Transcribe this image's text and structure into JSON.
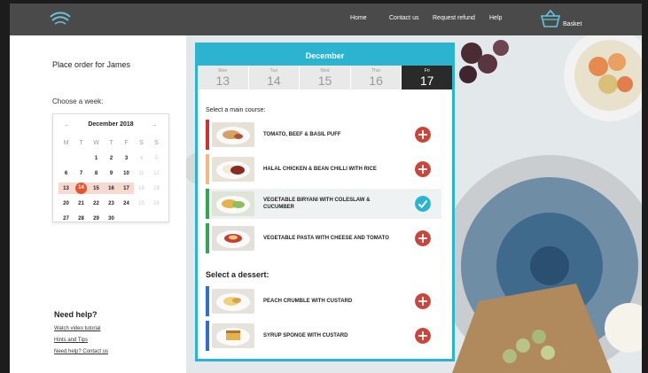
{
  "header": {
    "nav": [
      "Home",
      "Contact us",
      "Request refund",
      "Help"
    ],
    "basket_label": "Basket",
    "colors": {
      "bar": "#4a4a4a",
      "accent": "#2bb3cf"
    }
  },
  "sidebar": {
    "title": "Place order for James",
    "week_label": "Choose a week:",
    "calendar": {
      "month": "December 2018",
      "prev": "←",
      "next": "→",
      "dow": [
        "M",
        "T",
        "W",
        "T",
        "F",
        "S",
        "S"
      ],
      "weeks": [
        [
          "",
          "",
          "1",
          "2",
          "3",
          "4",
          "5"
        ],
        [
          "6",
          "7",
          "8",
          "9",
          "10",
          "11",
          "12"
        ],
        [
          "13",
          "14",
          "15",
          "16",
          "17",
          "18",
          "19"
        ],
        [
          "20",
          "21",
          "22",
          "23",
          "24",
          "25",
          "26"
        ],
        [
          "27",
          "28",
          "29",
          "30",
          "",
          "",
          ""
        ]
      ],
      "today": "14",
      "selected_week": [
        "13",
        "14",
        "15",
        "16",
        "17"
      ]
    },
    "help_title": "Need help?",
    "help_links": [
      "Watch video tutorial",
      "Hints and Tips",
      "Need help? Contact us"
    ]
  },
  "panel": {
    "month": "December",
    "days": [
      {
        "name": "Mon",
        "date": "13"
      },
      {
        "name": "Tue",
        "date": "14"
      },
      {
        "name": "Wed",
        "date": "15"
      },
      {
        "name": "Thur",
        "date": "16"
      },
      {
        "name": "Fri",
        "date": "17"
      }
    ],
    "active_day": 4,
    "main_title": "Select a main course:",
    "mains": [
      {
        "name": "TOMATO, BEEF & BASIL PUFF",
        "color": "#d0332b",
        "selected": false
      },
      {
        "name": "HALAL CHICKEN & BEAN CHILLI WITH RICE",
        "color": "#f5b97a",
        "selected": false
      },
      {
        "name": "VEGETABLE BIRYANI WITH COLESLAW & CUCUMBER",
        "color": "#2fa84f",
        "selected": true
      },
      {
        "name": "VEGETABLE PASTA WITH CHEESE AND TOMATO",
        "color": "#2fa84f",
        "selected": false
      }
    ],
    "dessert_title": "Select a dessert:",
    "desserts": [
      {
        "name": "PEACH CRUMBLE WITH CUSTARD",
        "color": "#2d6fd6",
        "selected": false
      },
      {
        "name": "SYRUP SPONGE WITH CUSTARD",
        "color": "#2d6fd6",
        "selected": false
      }
    ],
    "colors": {
      "add": "#c9463d",
      "check": "#2bb3cf"
    }
  }
}
